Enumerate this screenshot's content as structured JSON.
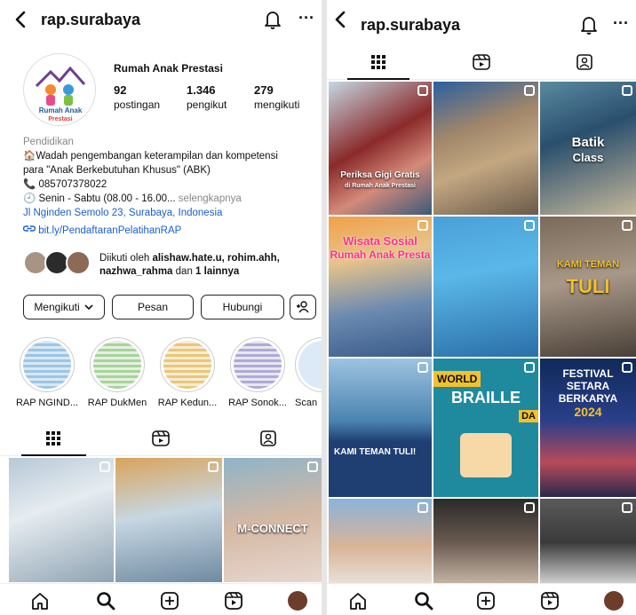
{
  "left": {
    "username": "rap.surabaya",
    "profile_name": "Rumah Anak Prestasi",
    "avatar_text": [
      "Rumah Anak",
      "Prestasi"
    ],
    "stats": [
      {
        "value": "92",
        "label": "postingan"
      },
      {
        "value": "1.346",
        "label": "pengikut"
      },
      {
        "value": "279",
        "label": "mengikuti"
      }
    ],
    "bio": {
      "category": "Pendidikan",
      "line1": "🏠Wadah pengembangan keterampilan dan kompetensi",
      "line2": "para \"Anak Berkebutuhan Khusus\" (ABK)",
      "phone": "📞 085707378022",
      "hours": "🕘 Senin - Sabtu (08.00 - 16.00...",
      "more": "selengkapnya",
      "address": "Jl Nginden Semolo 23, Surabaya, Indonesia",
      "link": "bit.ly/PendaftaranPelatihanRAP"
    },
    "followed_by": {
      "prefix": "Diikuti oleh ",
      "users": "alishaw.hate.u, rohim.ahh,",
      "user3": "nazhwa_rahma",
      "mid": " dan ",
      "others": "1 lainnya"
    },
    "buttons": {
      "follow": "Mengikuti",
      "message": "Pesan",
      "contact": "Hubungi"
    },
    "highlights": [
      "RAP NGIND...",
      "RAP DukMen",
      "RAP Kedun...",
      "RAP Sonok...",
      "Scan"
    ],
    "grid_overlay": "M-CONNECT"
  },
  "right": {
    "username": "rap.surabaya",
    "grid_overlays": {
      "gigi_1": "Periksa Gigi Gratis",
      "gigi_2": "di Rumah Anak Prestasi",
      "batik_1": "Batik",
      "batik_2": "Class",
      "wisata_1": "Wisata Sosial",
      "wisata_2": "Rumah Anak Presta",
      "teman_1": "KAMI TEMAN",
      "teman_2": "TULI",
      "kami_tuli": "KAMI TEMAN TULI!",
      "braille_1": "WORLD",
      "braille_2": "BRAILLE",
      "braille_3": "DA",
      "festival_1": "FESTIVAL",
      "festival_2": "SETARA",
      "festival_3": "BERKARYA",
      "festival_4": "2024"
    }
  },
  "colors": {
    "link": "#1a5fc9",
    "text": "#111111",
    "muted": "#888888"
  }
}
